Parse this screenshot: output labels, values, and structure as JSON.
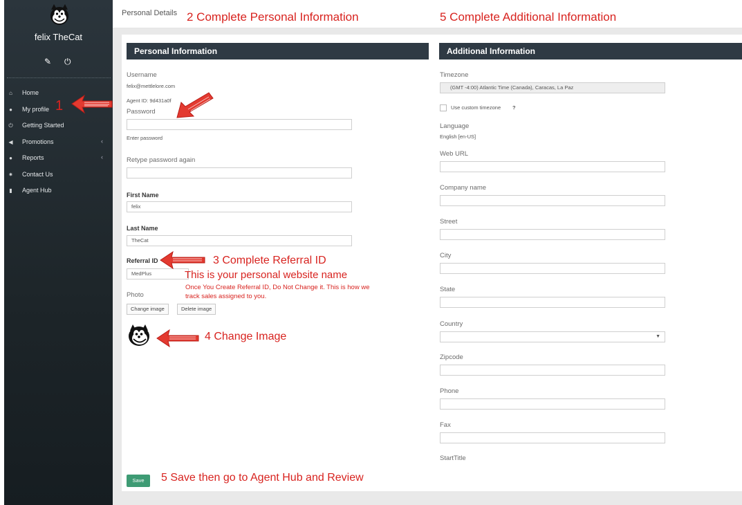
{
  "sidebar": {
    "user_name": "felix TheCat",
    "tool_edit_icon": "pencil-icon",
    "tool_power_icon": "power-icon",
    "items": [
      {
        "label": "Home",
        "icon": "home-icon",
        "glyph": "⌂"
      },
      {
        "label": "My profile",
        "icon": "user-icon",
        "glyph": "●"
      },
      {
        "label": "Getting Started",
        "icon": "power-icon",
        "glyph": "⏻"
      },
      {
        "label": "Promotions",
        "icon": "bullhorn-icon",
        "glyph": "◀",
        "chevron": "‹"
      },
      {
        "label": "Reports",
        "icon": "pie-icon",
        "glyph": "●",
        "chevron": "‹"
      },
      {
        "label": "Contact Us",
        "icon": "gear-icon",
        "glyph": "✷"
      },
      {
        "label": "Agent Hub",
        "icon": "book-icon",
        "glyph": "▮"
      }
    ]
  },
  "header": {
    "breadcrumb": "Personal Details"
  },
  "personal": {
    "heading": "Personal Information",
    "username_label": "Username",
    "username_value": "felix@mettlelore.com",
    "agent_id": "Agent ID: 9d431a0f",
    "password_label": "Password",
    "password_help": "Enter password",
    "retype_label": "Retype password again",
    "first_name_label": "First Name",
    "first_name_value": "felix",
    "last_name_label": "Last Name",
    "last_name_value": "TheCat",
    "referral_label": "Referral ID",
    "referral_value": "MedPlus",
    "photo_label": "Photo",
    "change_image": "Change image",
    "delete_image": "Delete image"
  },
  "additional": {
    "heading": "Additional Information",
    "timezone_label": "Timezone",
    "timezone_value": "(GMT -4:00) Atlantic Time (Canada), Caracas, La Paz",
    "custom_timezone": "Use custom timezone",
    "help_mark": "?",
    "language_label": "Language",
    "language_value": "English [en-US]",
    "web_url_label": "Web URL",
    "company_label": "Company name",
    "street_label": "Street",
    "city_label": "City",
    "state_label": "State",
    "country_label": "Country",
    "zipcode_label": "Zipcode",
    "phone_label": "Phone",
    "fax_label": "Fax",
    "start_title_label": "StartTitle"
  },
  "save_label": "Save",
  "annotations": {
    "a1": "1",
    "a2": "2 Complete Personal Information",
    "a3": "3 Complete Referral ID",
    "a3b": "This is your personal website name",
    "a3c": "Once You Create Referral ID, Do Not Change it.  This is how we",
    "a3d": "track sales assigned to you.",
    "a4": "4 Change Image",
    "a5": "5 Complete Additional Information",
    "a5b": "5 Save then go to Agent Hub and Review"
  },
  "colors": {
    "sidebar": "#1d2529",
    "panel_header": "#2f3a44",
    "save": "#3e9b74",
    "annotation": "#d8231f"
  }
}
